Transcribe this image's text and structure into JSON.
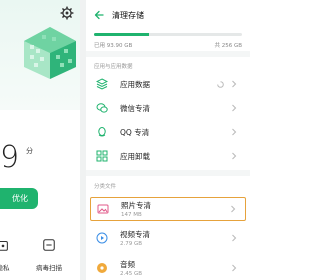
{
  "left": {
    "score_partial": "9",
    "score_unit": "分",
    "optimize_label": "优化",
    "tools": [
      {
        "label": "隐私",
        "icon": "privacy-icon"
      },
      {
        "label": "病毒扫描",
        "icon": "virus-scan-icon"
      }
    ],
    "accent": "#1fb36e"
  },
  "right": {
    "title": "清理存储",
    "storage": {
      "used_label": "已用 93.90 GB",
      "total_label": "共 256 GB",
      "used_fraction": 0.37
    },
    "section1": "应用与应用数据",
    "section2": "分类文件",
    "items": [
      {
        "name": "应用数据",
        "icon": "app-data-icon",
        "size": ""
      },
      {
        "name": "微信专清",
        "icon": "wechat-icon",
        "size": ""
      },
      {
        "name": "QQ 专清",
        "icon": "qq-icon",
        "size": ""
      },
      {
        "name": "应用卸载",
        "icon": "app-uninstall-icon",
        "size": ""
      },
      {
        "name": "照片专清",
        "icon": "photo-icon",
        "size": "147 MB"
      },
      {
        "name": "视频专清",
        "icon": "video-icon",
        "size": "2.79 GB"
      },
      {
        "name": "音频",
        "icon": "audio-icon",
        "size": "2.45 GB"
      }
    ],
    "highlight_color": "#e6a23c"
  }
}
